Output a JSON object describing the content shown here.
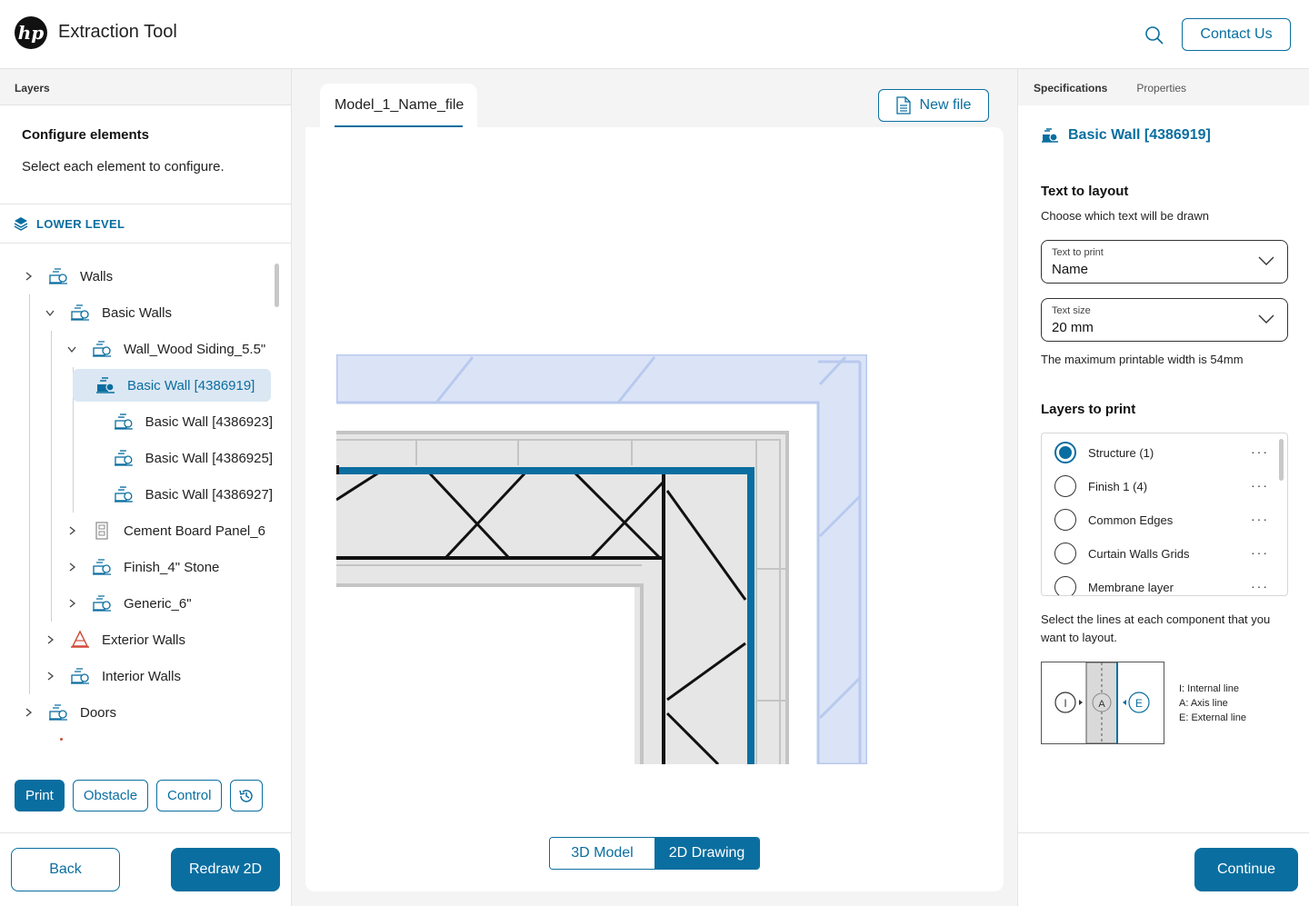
{
  "header": {
    "logo_text": "hp",
    "app_title": "Extraction Tool",
    "contact_label": "Contact Us",
    "search_icon": "search-icon"
  },
  "left_panel": {
    "tab_label": "Layers",
    "configure_title": "Configure elements",
    "configure_hint": "Select each element to configure.",
    "level_label": "LOWER LEVEL",
    "tree": [
      {
        "label": "Walls",
        "depth": 0,
        "expander": "collapsed",
        "icon": "wall-icon"
      },
      {
        "label": "Basic Walls",
        "depth": 1,
        "expander": "expanded",
        "icon": "wall-icon"
      },
      {
        "label": "Wall_Wood Siding_5.5\"",
        "depth": 2,
        "expander": "expanded",
        "icon": "wall-icon"
      },
      {
        "label": "Basic Wall [4386919]",
        "depth": 3,
        "expander": "none",
        "icon": "wall-filled-icon",
        "selected": true
      },
      {
        "label": "Basic Wall [4386923]",
        "depth": 3,
        "expander": "none",
        "icon": "wall-icon"
      },
      {
        "label": "Basic Wall [4386925]",
        "depth": 3,
        "expander": "none",
        "icon": "wall-icon"
      },
      {
        "label": "Basic Wall [4386927]",
        "depth": 3,
        "expander": "none",
        "icon": "wall-icon"
      },
      {
        "label": "Cement Board Panel_6",
        "depth": 2,
        "expander": "collapsed",
        "icon": "panel-icon"
      },
      {
        "label": "Finish_4\" Stone",
        "depth": 2,
        "expander": "collapsed",
        "icon": "wall-icon"
      },
      {
        "label": "Generic_6\"",
        "depth": 2,
        "expander": "collapsed",
        "icon": "wall-icon"
      },
      {
        "label": "Exterior Walls",
        "depth": 1,
        "expander": "collapsed",
        "icon": "warning-cone-icon"
      },
      {
        "label": "Interior Walls",
        "depth": 1,
        "expander": "collapsed",
        "icon": "wall-icon"
      },
      {
        "label": "Doors",
        "depth": 0,
        "expander": "collapsed",
        "icon": "wall-icon"
      }
    ],
    "mode_buttons": {
      "print": "Print",
      "obstacle": "Obstacle",
      "control": "Control",
      "history_icon": "history-icon"
    },
    "back_label": "Back",
    "redraw_label": "Redraw 2D"
  },
  "center": {
    "file_tab_label": "Model_1_Name_file",
    "new_file_label": "New file",
    "view_3d_label": "3D Model",
    "view_2d_label": "2D Drawing",
    "active_view": "2D Drawing"
  },
  "right_panel": {
    "tab_specifications": "Specifications",
    "tab_properties": "Properties",
    "element_title": "Basic Wall [4386919]",
    "text_to_layout_title": "Text to layout",
    "text_to_layout_hint": "Choose which text will be drawn",
    "text_to_print": {
      "label": "Text to print",
      "value": "Name"
    },
    "text_size": {
      "label": "Text size",
      "value": "20 mm"
    },
    "max_width_note": "The maximum printable width is 54mm",
    "layers_title": "Layers to print",
    "layers": [
      {
        "label": "Structure (1)",
        "selected": true
      },
      {
        "label": "Finish 1 (4)",
        "selected": false
      },
      {
        "label": "Common Edges",
        "selected": false
      },
      {
        "label": "Curtain Walls Grids",
        "selected": false
      },
      {
        "label": "Membrane layer",
        "selected": false
      }
    ],
    "lines_hint": "Select the lines at each component that you want to layout.",
    "legend": {
      "i_marker": "I",
      "a_marker": "A",
      "e_marker": "E",
      "internal": "I: Internal line",
      "axis": "A: Axis line",
      "external": "E: External line"
    },
    "continue_label": "Continue"
  },
  "colors": {
    "accent": "#0a6ea0",
    "selected_bg": "#dbe7f3",
    "drawing_light_blue": "#dbe4f7"
  }
}
